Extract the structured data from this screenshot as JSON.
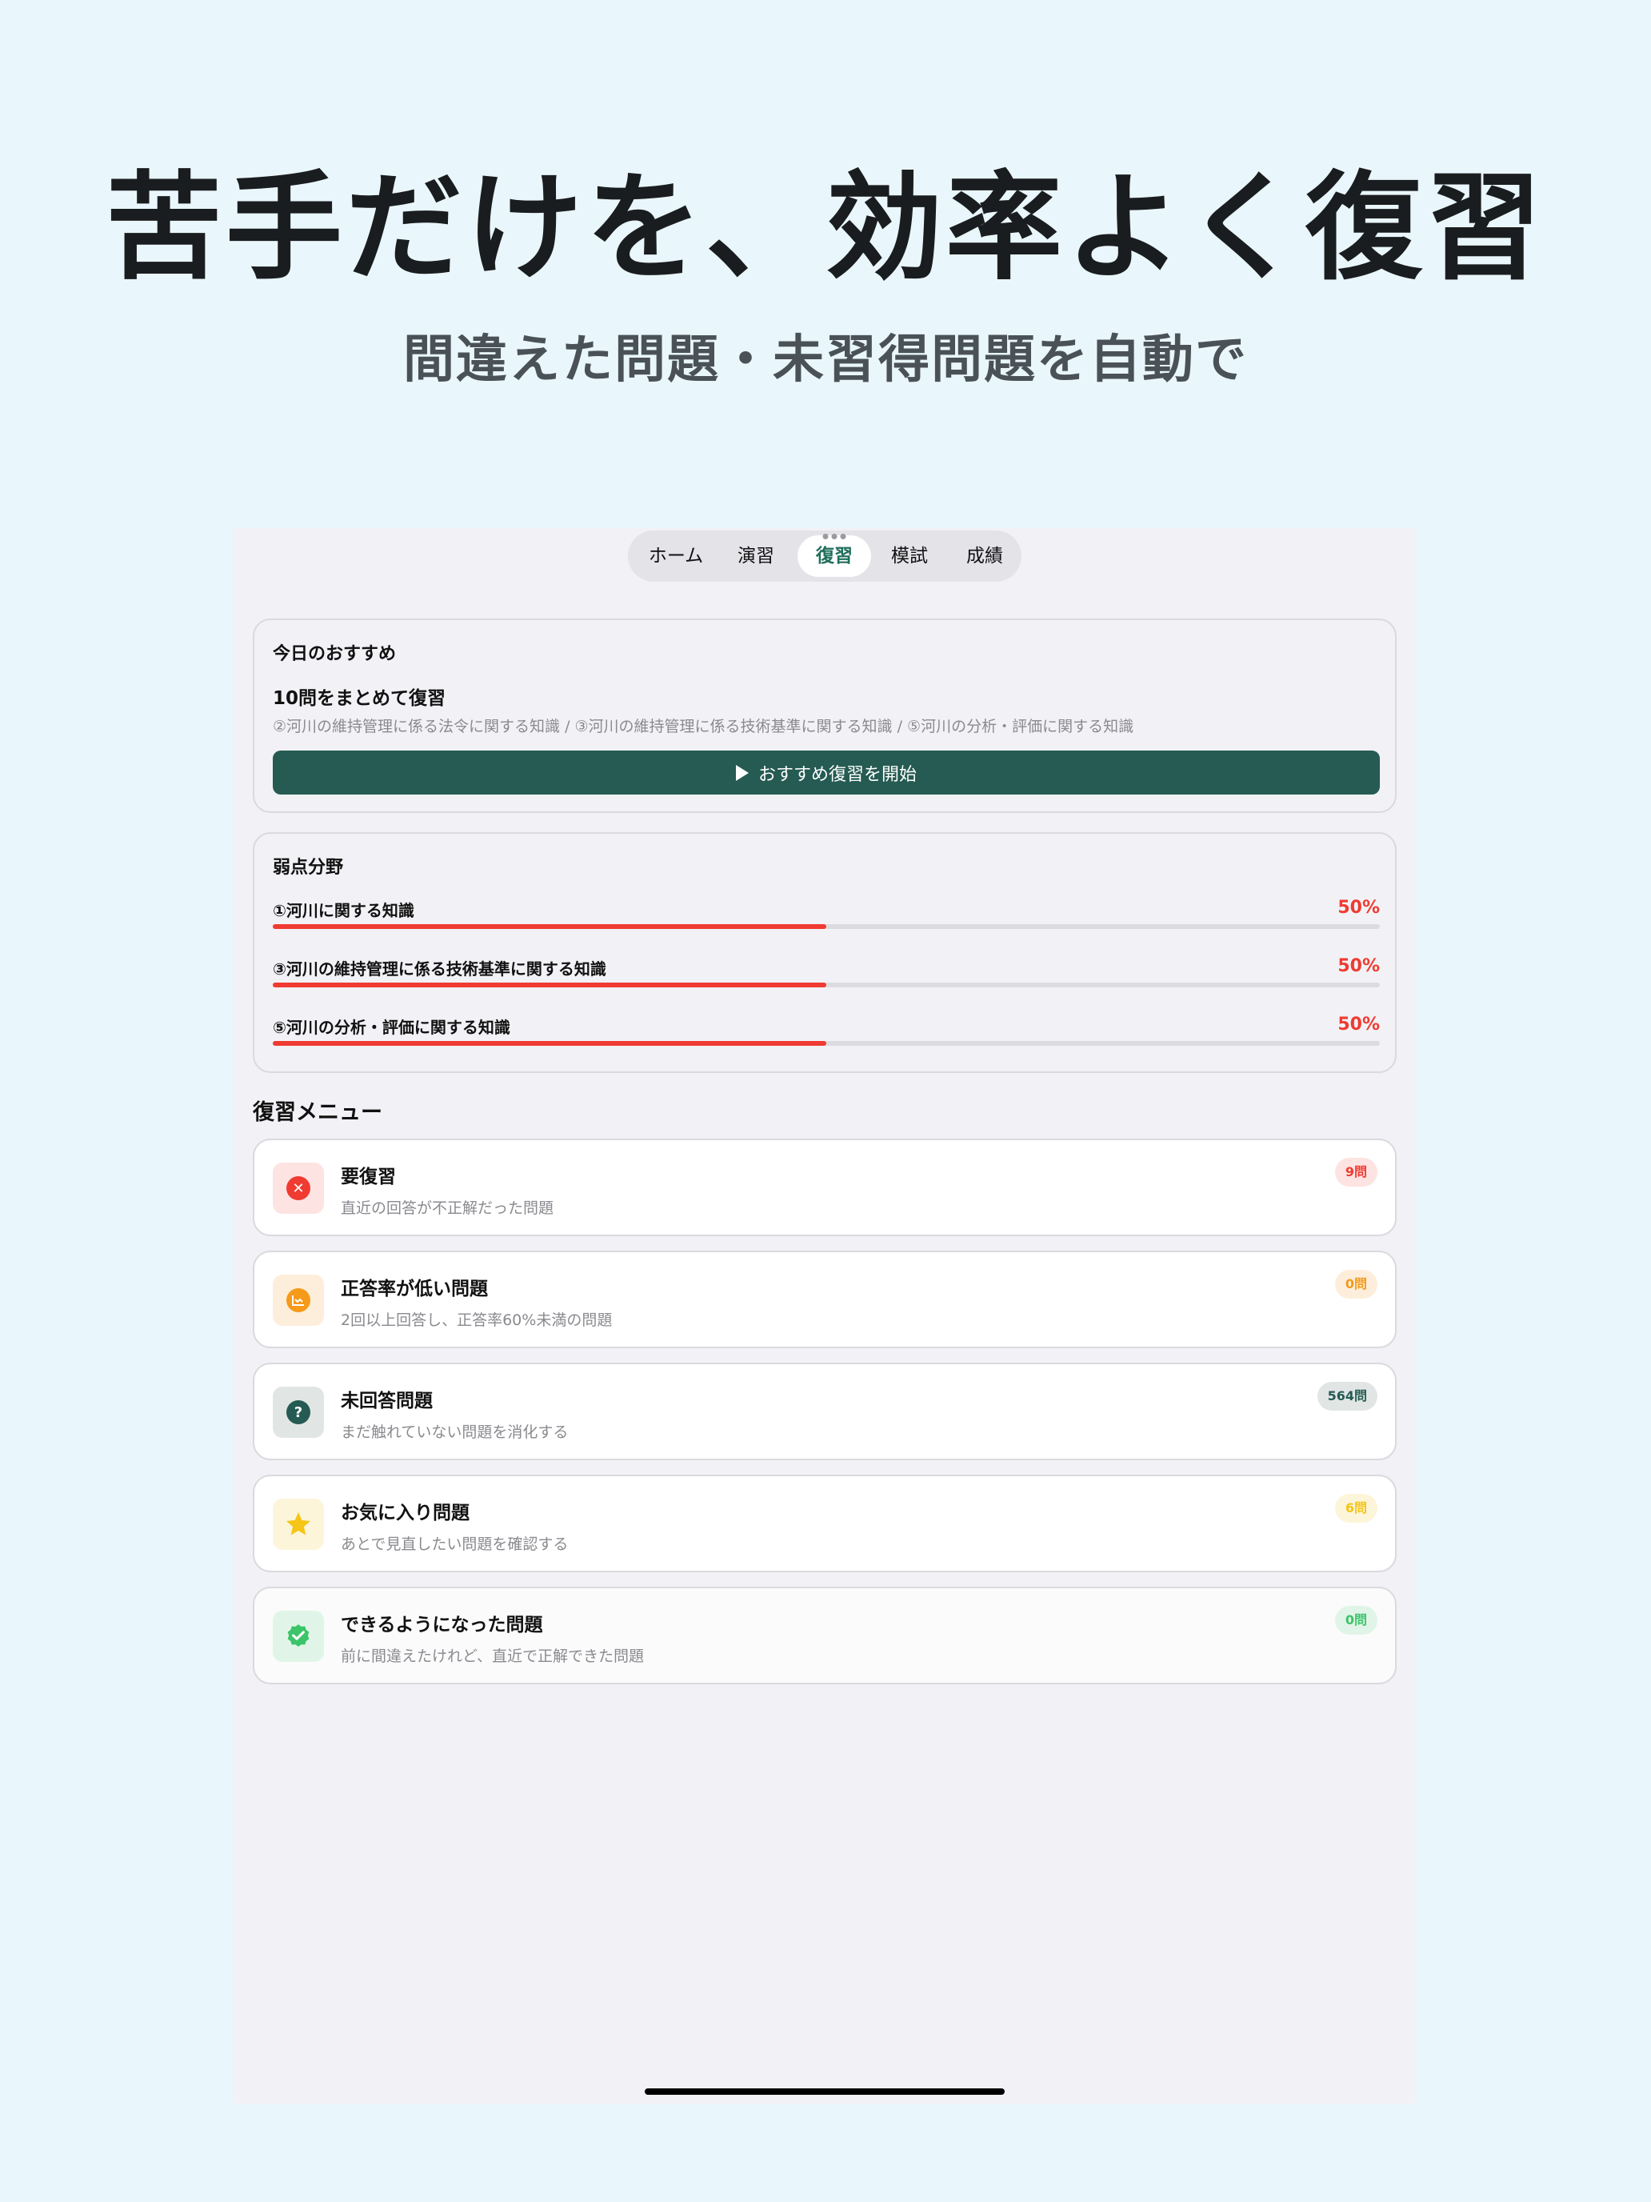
{
  "hero": {
    "title": "苦手だけを、効率よく復習",
    "subtitle": "間違えた問題・未習得問題を自動で"
  },
  "tabs": [
    {
      "label": "ホーム"
    },
    {
      "label": "演習"
    },
    {
      "label": "復習",
      "active": true
    },
    {
      "label": "模試"
    },
    {
      "label": "成績"
    }
  ],
  "recommend": {
    "heading": "今日のおすすめ",
    "subtitle": "10問をまとめて復習",
    "description": "②河川の維持管理に係る法令に関する知識 / ③河川の維持管理に係る技術基準に関する知識 / ⑤河川の分析・評価に関する知識",
    "button_label": "おすすめ復習を開始",
    "button_icon": "play-icon"
  },
  "weak_areas": {
    "heading": "弱点分野",
    "accent_color": "#ef3b31",
    "items": [
      {
        "label": "①河川に関する知識",
        "percent_text": "50%",
        "fraction": 0.5
      },
      {
        "label": "③河川の維持管理に係る技術基準に関する知識",
        "percent_text": "50%",
        "fraction": 0.5
      },
      {
        "label": "⑤河川の分析・評価に関する知識",
        "percent_text": "50%",
        "fraction": 0.5
      }
    ]
  },
  "review_menu": {
    "heading": "復習メニュー",
    "items": [
      {
        "title": "要復習",
        "description": "直近の回答が不正解だった問題",
        "badge": "9問",
        "icon": "x-circle-icon",
        "color": "#ef3b31",
        "tint": "#fde3e1"
      },
      {
        "title": "正答率が低い問題",
        "description": "2回以上回答し、正答率60%未満の問題",
        "badge": "0問",
        "icon": "chart-down-icon",
        "color": "#f59a1a",
        "tint": "#fdeedb"
      },
      {
        "title": "未回答問題",
        "description": "まだ触れていない問題を消化する",
        "badge": "564問",
        "icon": "question-circle-icon",
        "color": "#255b52",
        "tint": "#e1e6e5"
      },
      {
        "title": "お気に入り問題",
        "description": "あとで見直したい問題を確認する",
        "badge": "6問",
        "icon": "star-icon",
        "color": "#f5c518",
        "tint": "#fdf5d9"
      },
      {
        "title": "できるようになった問題",
        "description": "前に間違えたけれど、直近で正解できた問題",
        "badge": "0問",
        "icon": "check-badge-icon",
        "color": "#3cc46a",
        "tint": "#e0f5e7"
      }
    ]
  },
  "colors": {
    "primary": "#255b52",
    "background": "#e9f6fb"
  }
}
